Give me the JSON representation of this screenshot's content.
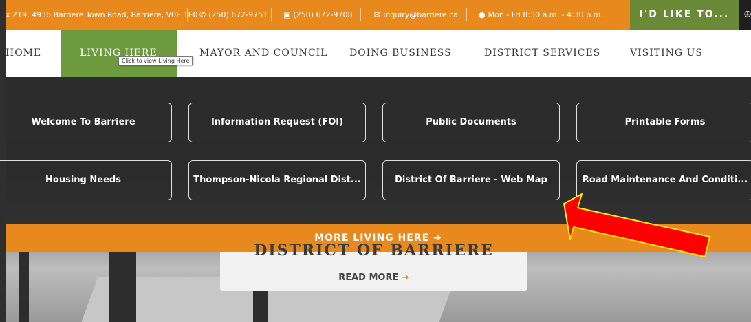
{
  "topbar": {
    "address": "x 219, 4936 Barriere Town Road, Barriere, V0E 1E0",
    "phone": "(250) 672-9751",
    "fax": "(250) 672-9708",
    "email": "inquiry@barriere.ca",
    "hours": "Mon - Fri 8:30 a.m. - 4:30 p.m.",
    "cta": "I'D LIKE TO...",
    "extra": "⊕"
  },
  "nav": {
    "items": [
      "HOME",
      "LIVING HERE",
      "MAYOR AND COUNCIL",
      "DOING BUSINESS",
      "DISTRICT SERVICES",
      "VISITING US"
    ],
    "tooltip": "Click to view Living Here"
  },
  "menu": {
    "tiles": [
      "Welcome To Barriere",
      "Information Request (FOI)",
      "Public Documents",
      "Printable Forms",
      "Housing Needs",
      "Thompson-Nicola Regional Dist...",
      "District Of Barriere - Web Map",
      "Road Maintenance And Conditi..."
    ],
    "more": "MORE LIVING HERE"
  },
  "hero": {
    "title": "DISTRICT OF BARRIERE",
    "read_more": "READ MORE"
  },
  "colors": {
    "orange": "#e8891d",
    "green": "#6d9a3e",
    "arrow": "#ff0000"
  }
}
